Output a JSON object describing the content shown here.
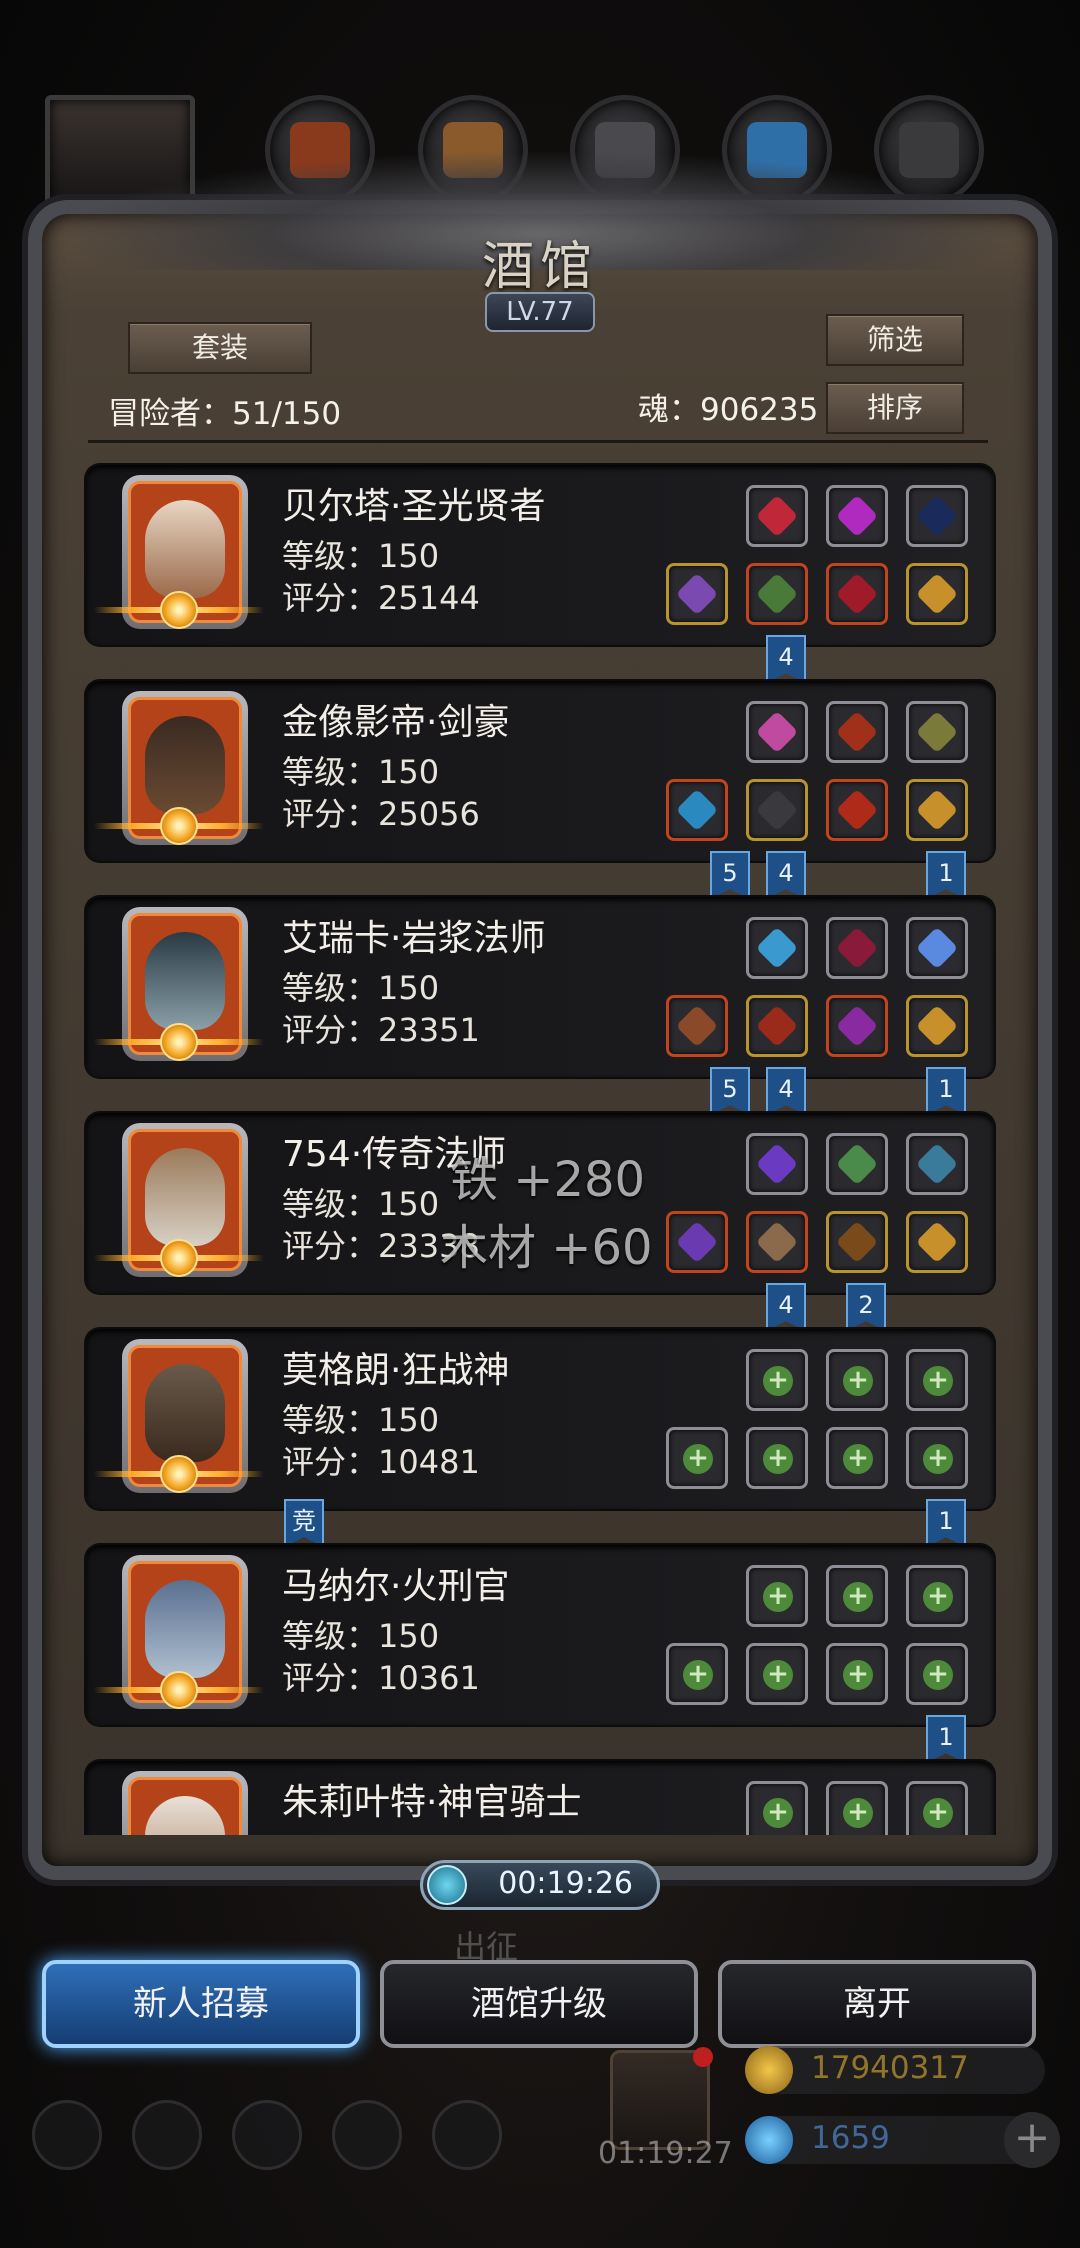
{
  "tavern": {
    "title": "酒馆",
    "level": "LV.77",
    "set_button": "套装",
    "filter_button": "筛选",
    "sort_button": "排序",
    "adventurers": "冒险者：51/150",
    "soul": "魂：906235"
  },
  "heroes": [
    {
      "name": "贝尔塔·圣光贤者",
      "level": "等级：150",
      "score": "评分：25144"
    },
    {
      "name": "金像影帝·剑豪",
      "level": "等级：150",
      "score": "评分：25056"
    },
    {
      "name": "艾瑞卡·岩浆法师",
      "level": "等级：150",
      "score": "评分：23351"
    },
    {
      "name": "754·传奇法师",
      "level": "等级：150",
      "score": "评分：23338"
    },
    {
      "name": "莫格朗·狂战神",
      "level": "等级：150",
      "score": "评分：10481"
    },
    {
      "name": "马纳尔·火刑官",
      "level": "等级：150",
      "score": "评分：10361"
    },
    {
      "name": "朱莉叶特·神官骑士",
      "level": "",
      "score": ""
    }
  ],
  "flags": {
    "f1": "4",
    "f2a": "5",
    "f2b": "4",
    "f2c": "1",
    "f3a": "5",
    "f3b": "4",
    "f3c": "1",
    "f4a": "4",
    "f4b": "2",
    "f5a": "竞",
    "f5b": "1",
    "f6": "1"
  },
  "floating": {
    "iron": "铁 +280",
    "wood": "木材 +60"
  },
  "timer": "00:19:26",
  "ghost_label": "出征",
  "buttons": {
    "recruit": "新人招募",
    "upgrade": "酒馆升级",
    "leave": "离开"
  },
  "hud": {
    "gold": "17940317",
    "gems": "1659",
    "gift_timer": "01:19:27",
    "add": "+"
  },
  "colors": {
    "accent_blue": "#2f6fb8",
    "gold_currency": "#b8932e",
    "portrait_orange": "#b4431a"
  }
}
